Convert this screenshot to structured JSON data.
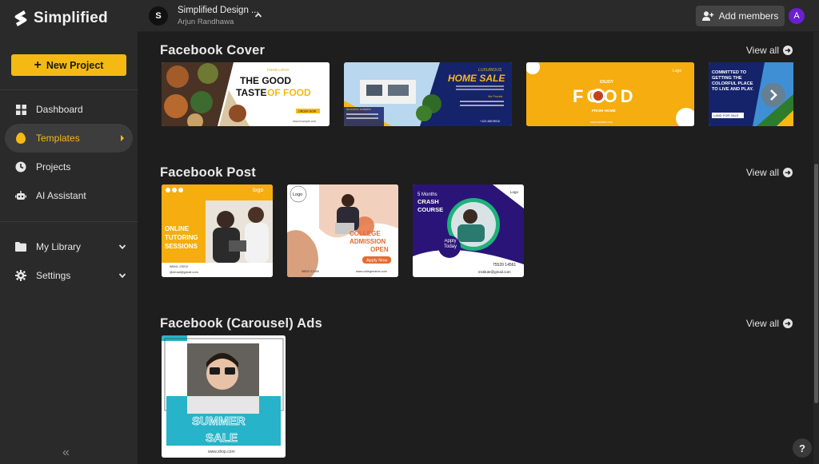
{
  "brand": {
    "name": "Simplified"
  },
  "sidebar": {
    "new_project_label": "New Project",
    "items": [
      {
        "label": "Dashboard"
      },
      {
        "label": "Templates"
      },
      {
        "label": "Projects"
      },
      {
        "label": "AI Assistant"
      },
      {
        "label": "My Library"
      },
      {
        "label": "Settings"
      }
    ]
  },
  "topbar": {
    "workspace_initial": "S",
    "workspace_title": "Simplified Design ...",
    "workspace_owner": "Arjun Randhawa",
    "add_members_label": "Add members",
    "user_initial": "A"
  },
  "sections": [
    {
      "title": "Facebook Cover",
      "view_all": "View all",
      "cards": [
        {
          "line1": "THE GOOD",
          "line2": "TASTE",
          "line3": "OF FOOD",
          "brand": "FOOD LOGO",
          "cta": "ORDER NOW",
          "site": "www.example.com"
        },
        {
          "line1": "LUXURIOUS",
          "line2": "HOME SALE",
          "tag": "Amenities available",
          "tag2": "We Provide",
          "phone": "+123 45678910"
        },
        {
          "line1": "ENJOY",
          "line2": "FOOD",
          "line3": "FROM HOME",
          "logo": "Logo",
          "site": "www.website.com"
        },
        {
          "line1": "COMMITTED TO GETTING THE COLORFUL PLACE TO LIVE AND PLAY.",
          "cta": "LAND FOR SALE"
        }
      ]
    },
    {
      "title": "Facebook Post",
      "view_all": "View all",
      "cards": [
        {
          "logo": "logo",
          "line1": "ONLINE",
          "line2": "TUTORING",
          "line3": "SESSIONS",
          "phone": "98541 23010",
          "email": "@email@gmail.com"
        },
        {
          "logo": "Logo",
          "line1": "COLLEGE",
          "line2": "ADMISSION",
          "line3": "OPEN",
          "cta": "Apply Now",
          "phone": "98520 12450",
          "site": "www.collegename.com"
        },
        {
          "logo": "Logo",
          "line1": "5 Months",
          "line2": "CRASH",
          "line3": "COURSE",
          "cta": "Apply Today",
          "phone": "75520 14561",
          "email": "institute@gmail.com"
        }
      ]
    },
    {
      "title": "Facebook (Carousel) Ads",
      "view_all": "View all",
      "cards": [
        {
          "line1": "SUMMER",
          "line2": "SALE",
          "site": "www.shop.com"
        }
      ]
    }
  ],
  "colors": {
    "accent": "#f5b914",
    "bg": "#1e1e1e",
    "sidebar": "#2a2a2a",
    "avatar": "#6a1fd1"
  }
}
